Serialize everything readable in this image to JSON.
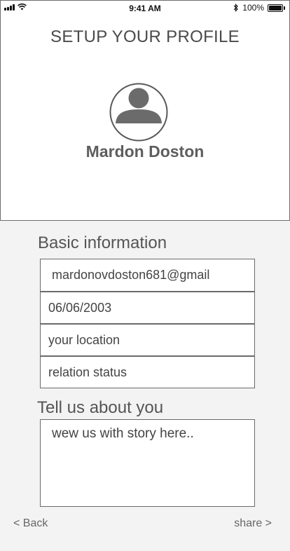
{
  "status_bar": {
    "time": "9:41 AM",
    "battery": "100%"
  },
  "header": {
    "title": "SETUP YOUR PROFILE"
  },
  "profile": {
    "name": "Mardon Doston",
    "avatar_icon": "user-avatar-icon"
  },
  "basic_info": {
    "title": "Basic information",
    "email_value": "mardonovdoston681@gmail",
    "dob_value": "06/06/2003",
    "location_placeholder": "your location",
    "relation_placeholder": "relation status"
  },
  "about": {
    "title": "Tell us about you",
    "story_placeholder": "wew us with story here.."
  },
  "footer": {
    "back_label": "< Back",
    "share_label": "share  >"
  }
}
